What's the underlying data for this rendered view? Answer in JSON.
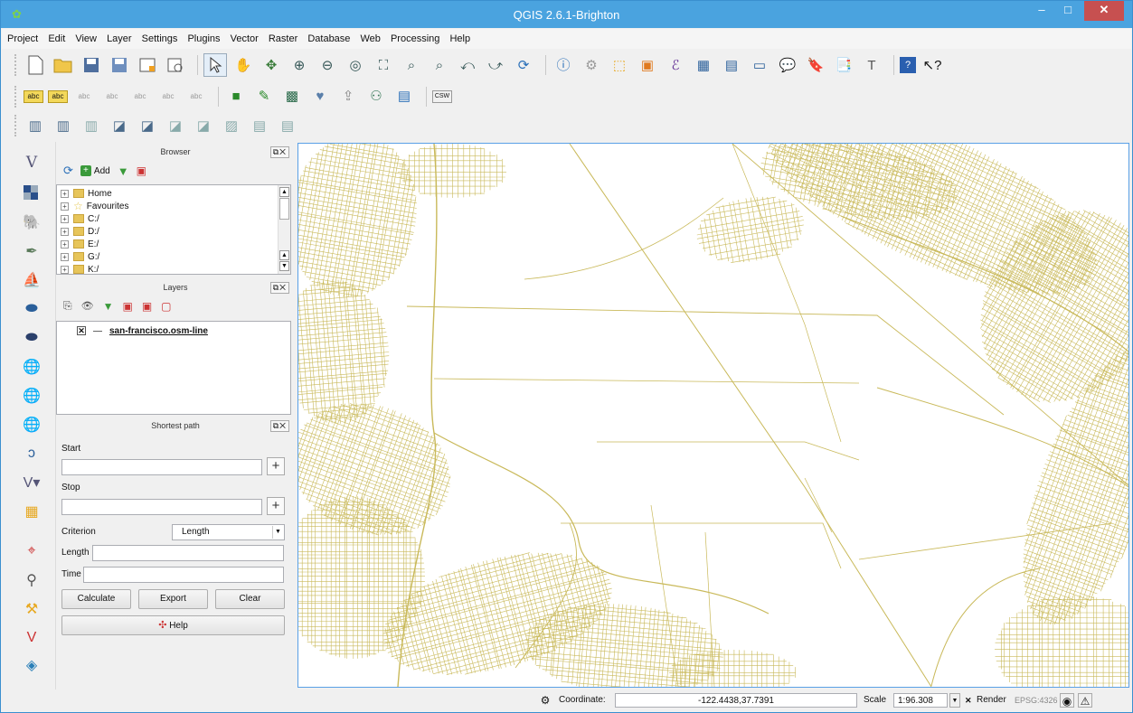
{
  "window": {
    "title": "QGIS 2.6.1-Brighton",
    "min": "–",
    "max": "□",
    "close": "✕"
  },
  "menu": [
    "Project",
    "Edit",
    "View",
    "Layer",
    "Settings",
    "Plugins",
    "Vector",
    "Raster",
    "Database",
    "Web",
    "Processing",
    "Help"
  ],
  "browser": {
    "title": "Browser",
    "add_label": "Add",
    "items": [
      "Home",
      "Favourites",
      "C:/",
      "D:/",
      "E:/",
      "G:/",
      "K:/"
    ]
  },
  "layers": {
    "title": "Layers",
    "items": [
      {
        "name": "san-francisco.osm-line",
        "checked": true
      }
    ]
  },
  "shortest_path": {
    "title": "Shortest path",
    "start_label": "Start",
    "stop_label": "Stop",
    "criterion_label": "Criterion",
    "criterion_value": "Length",
    "length_label": "Length",
    "time_label": "Time",
    "calculate": "Calculate",
    "export": "Export",
    "clear": "Clear",
    "help": "Help"
  },
  "status": {
    "coordinate_label": "Coordinate:",
    "coordinate_value": "-122.4438,37.7391",
    "scale_label": "Scale",
    "scale_value": "1:96.308",
    "render_label": "Render",
    "crs": "EPSG:4326"
  },
  "colors": {
    "titlebar": "#4aa3df",
    "map_lines": "#c9b95a",
    "close_button": "#c75050"
  }
}
